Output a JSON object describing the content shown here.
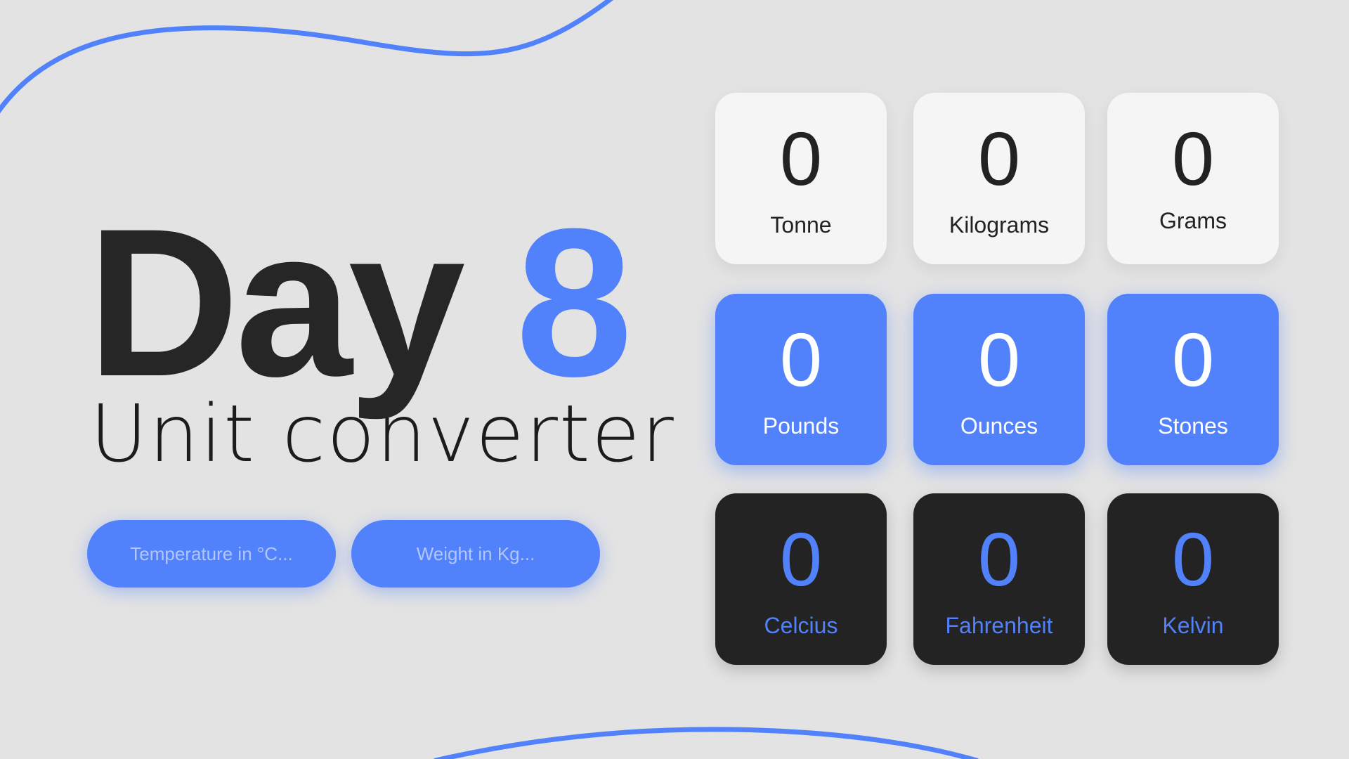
{
  "title": {
    "day_word": "Day",
    "day_number": "8",
    "subtitle": "Unit converter"
  },
  "inputs": {
    "temperature_placeholder": "Temperature in °C...",
    "weight_placeholder": "Weight in Kg..."
  },
  "weight_metric": [
    {
      "value": "0",
      "label": "Tonne"
    },
    {
      "value": "0",
      "label": "Kilograms"
    },
    {
      "value": "0",
      "label": "Grams"
    }
  ],
  "weight_imperial": [
    {
      "value": "0",
      "label": "Pounds"
    },
    {
      "value": "0",
      "label": "Ounces"
    },
    {
      "value": "0",
      "label": "Stones"
    }
  ],
  "temperature": [
    {
      "value": "0",
      "label": "Celcius"
    },
    {
      "value": "0",
      "label": "Fahrenheit"
    },
    {
      "value": "0",
      "label": "Kelvin"
    }
  ],
  "colors": {
    "accent": "#5182fb",
    "background": "#e3e3e3",
    "dark": "#232323",
    "light_tile": "#f5f5f5"
  }
}
